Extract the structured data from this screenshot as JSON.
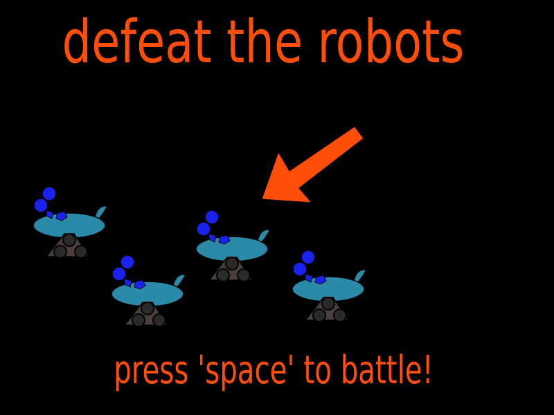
{
  "screen": {
    "title": "defeat the robots",
    "prompt": "press 'space' to battle!"
  },
  "colors": {
    "background": "#000000",
    "text": "#ff4d0a",
    "arrow": "#ff4d0a",
    "robot_body": "#2a8aa8",
    "robot_antenna": "#1a22ee",
    "robot_base": "#4a3f3a",
    "robot_wheel": "#2a2a2a"
  },
  "robots": {
    "count": 4,
    "enemy_sprite": "robot-enemy-icon"
  },
  "arrow_icon": "arrow-down-left-icon"
}
